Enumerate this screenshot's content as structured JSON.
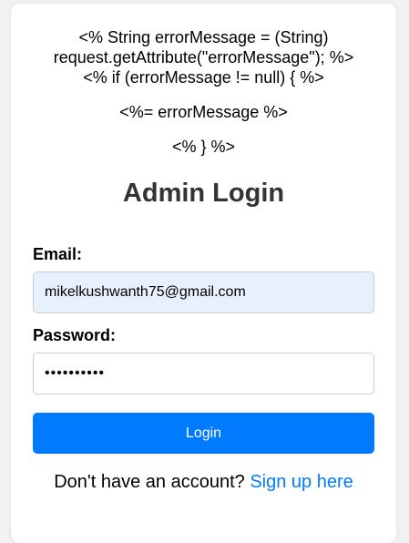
{
  "jsp": {
    "line1": "<% String errorMessage = (String)",
    "line2": "request.getAttribute(\"errorMessage\"); %>",
    "line3": "<% if (errorMessage != null) { %>",
    "line4": "<%= errorMessage %>",
    "line5": "<% } %>"
  },
  "form": {
    "title": "Admin Login",
    "email_label": "Email:",
    "email_value": "mikelkushwanth75@gmail.com",
    "password_label": "Password:",
    "password_value": "••••••••••",
    "login_label": "Login"
  },
  "footer": {
    "prompt": "Don't have an account?",
    "link_label": "Sign up here"
  },
  "colors": {
    "accent": "#007bff",
    "autofill_bg": "#e8f0fe",
    "title": "#333333"
  }
}
